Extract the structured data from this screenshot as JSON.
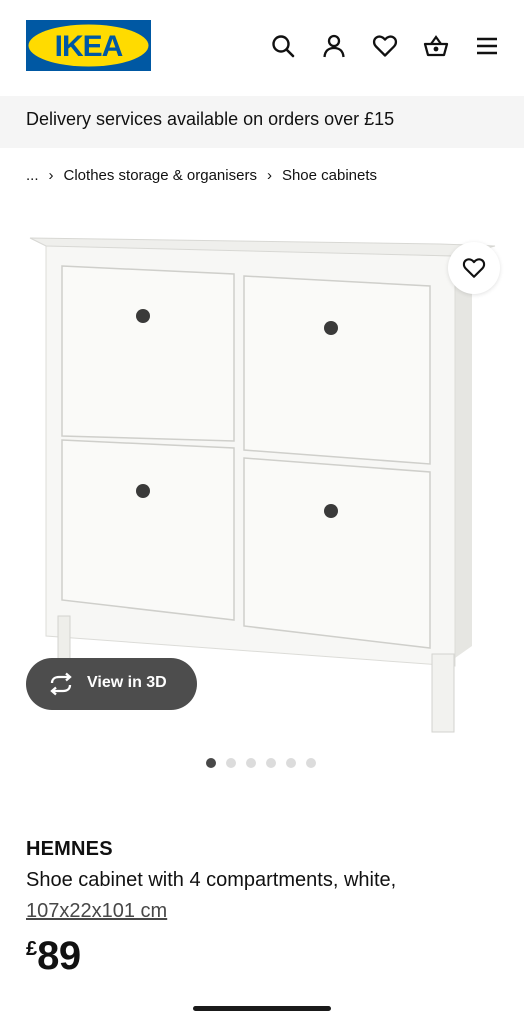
{
  "header": {
    "logo_text": "IKEA",
    "brand_colors": {
      "blue": "#0058a3",
      "yellow": "#ffdb00"
    },
    "icons": [
      "search-icon",
      "account-icon",
      "heart-icon",
      "basket-icon",
      "menu-icon"
    ]
  },
  "banner": {
    "text": "Delivery services available on orders over £15"
  },
  "breadcrumb": {
    "ellipsis": "...",
    "items": [
      "Clothes storage & organisers",
      "Shoe cabinets"
    ]
  },
  "gallery": {
    "view_3d_label": "View in 3D",
    "dot_count": 6,
    "active_index": 0
  },
  "product": {
    "name": "HEMNES",
    "description": "Shoe cabinet with 4 compartments, white,",
    "size": "107x22x101 cm",
    "price_currency": "£",
    "price": "89"
  }
}
